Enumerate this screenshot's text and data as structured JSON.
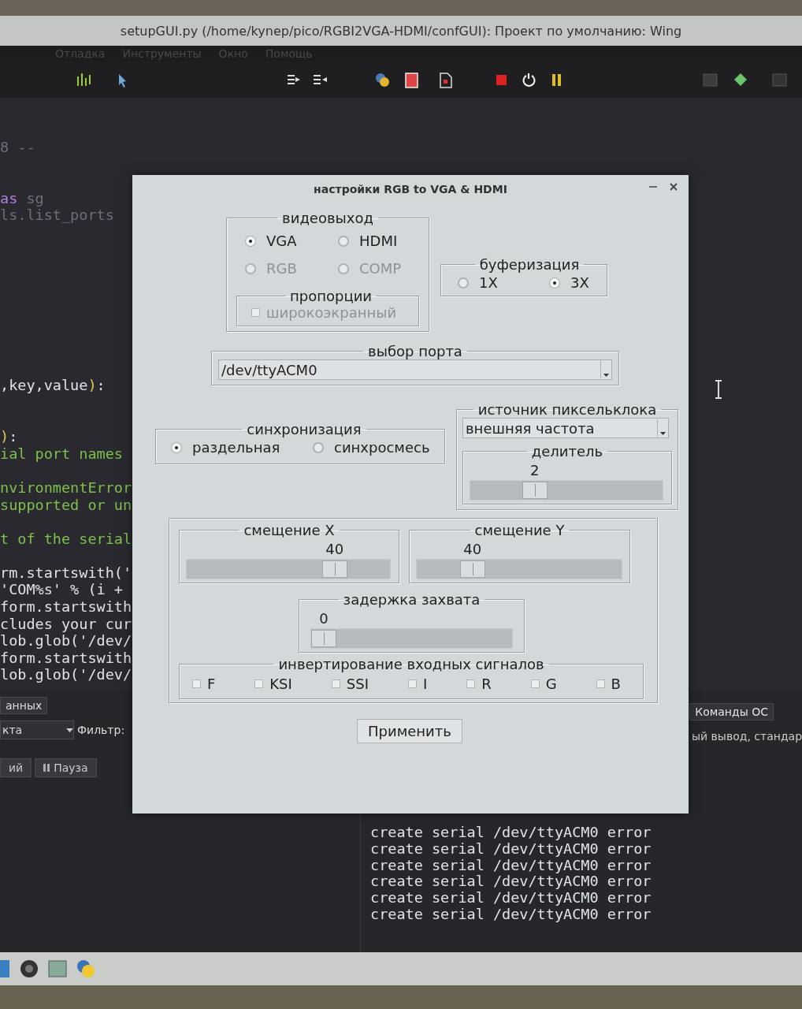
{
  "ide": {
    "title": "setupGUI.py (/home/kynep/pico/RGBI2VGA-HDMI/confGUI): Проект по умолчанию: Wing",
    "menu": [
      "Отладка",
      "Инструменты",
      "Окно",
      "Помощь"
    ],
    "code_lines": [
      [
        {
          "text": "8 --",
          "kind": "faint"
        }
      ],
      [
        {
          "text": "as",
          "kind": "keyword"
        },
        {
          "text": " sg",
          "kind": "faint"
        }
      ],
      [
        {
          "text": "ls.list_ports",
          "kind": "faint"
        }
      ],
      [
        {
          "text": ",key,value",
          "kind": "plain"
        },
        {
          "text": ")",
          "kind": "paren"
        },
        {
          "text": ":",
          "kind": "plain"
        }
      ],
      [
        {
          "text": ")",
          "kind": "paren"
        },
        {
          "text": ":",
          "kind": "plain"
        }
      ],
      [
        {
          "text": "ial port names",
          "kind": "comment"
        }
      ],
      [
        {
          "text": "nvironmentError",
          "kind": "comment"
        }
      ],
      [
        {
          "text": "supported or un",
          "kind": "comment"
        }
      ],
      [
        {
          "text": "t of the serial",
          "kind": "comment"
        }
      ],
      [
        {
          "text": "rm.startswith('",
          "kind": "plain"
        }
      ],
      [
        {
          "text": "'COM%s' % (i +",
          "kind": "plain"
        }
      ],
      [
        {
          "text": "form.startswith",
          "kind": "plain"
        }
      ],
      [
        {
          "text": "cludes your cur",
          "kind": "plain"
        }
      ],
      [
        {
          "text": "lob.glob('/dev/",
          "kind": "plain"
        }
      ],
      [
        {
          "text": "form.startswith",
          "kind": "plain"
        }
      ],
      [
        {
          "text": "lob.glob('/dev/",
          "kind": "plain"
        }
      ]
    ],
    "data_panel": {
      "tab": "анных",
      "dropdown": "кта",
      "filter_label": "Фильтр:",
      "buttons": [
        {
          "label": "ий"
        },
        {
          "label": "Пауза"
        }
      ]
    },
    "os_panel": {
      "tab": "Команды ОС",
      "header": "ый вывод, стандар",
      "output": [
        "create serial /dev/ttyACM0 error",
        "create serial /dev/ttyACM0 error",
        "create serial /dev/ttyACM0 error",
        "create serial /dev/ttyACM0 error",
        "create serial /dev/ttyACM0 error",
        "create serial /dev/ttyACM0 error"
      ]
    }
  },
  "dialog": {
    "title": "настройки RGB to VGA & HDMI",
    "video_output": {
      "title": "видеовыход",
      "options": [
        {
          "label": "VGA",
          "selected": true,
          "disabled": false
        },
        {
          "label": "HDMI",
          "selected": false,
          "disabled": false
        },
        {
          "label": "RGB",
          "selected": false,
          "disabled": true
        },
        {
          "label": "COMP",
          "selected": false,
          "disabled": true
        }
      ],
      "proportions": {
        "title": "пропорции",
        "checkbox": {
          "label": "широкоэкранный",
          "checked": false,
          "disabled": true
        }
      }
    },
    "buffering": {
      "title": "буферизация",
      "options": [
        {
          "label": "1X",
          "selected": false
        },
        {
          "label": "3X",
          "selected": true
        }
      ]
    },
    "port": {
      "title": "выбор порта",
      "value": "/dev/ttyACM0"
    },
    "sync": {
      "title": "синхронизация",
      "options": [
        {
          "label": "раздельная",
          "selected": true
        },
        {
          "label": "синхросмесь",
          "selected": false
        }
      ]
    },
    "pixel_clock": {
      "title": "источник пиксельклока",
      "value": "внешняя частота",
      "divider": {
        "title": "делитель",
        "reading": "2",
        "level": 0.31
      }
    },
    "offset_x": {
      "title": "смещение X",
      "reading": "40",
      "level": 0.76
    },
    "offset_y": {
      "title": "смещение Y",
      "reading": "40",
      "level": 0.24
    },
    "capture_delay": {
      "title": "задержка захвата",
      "reading": "0",
      "level": 0
    },
    "invert": {
      "title": "инвертирование входных сигналов",
      "signals": [
        {
          "label": "F",
          "checked": false
        },
        {
          "label": "KSI",
          "checked": false
        },
        {
          "label": "SSI",
          "checked": false
        },
        {
          "label": "I",
          "checked": false
        },
        {
          "label": "R",
          "checked": false
        },
        {
          "label": "G",
          "checked": false
        },
        {
          "label": "B",
          "checked": false
        }
      ]
    },
    "apply_button": "Применить"
  }
}
